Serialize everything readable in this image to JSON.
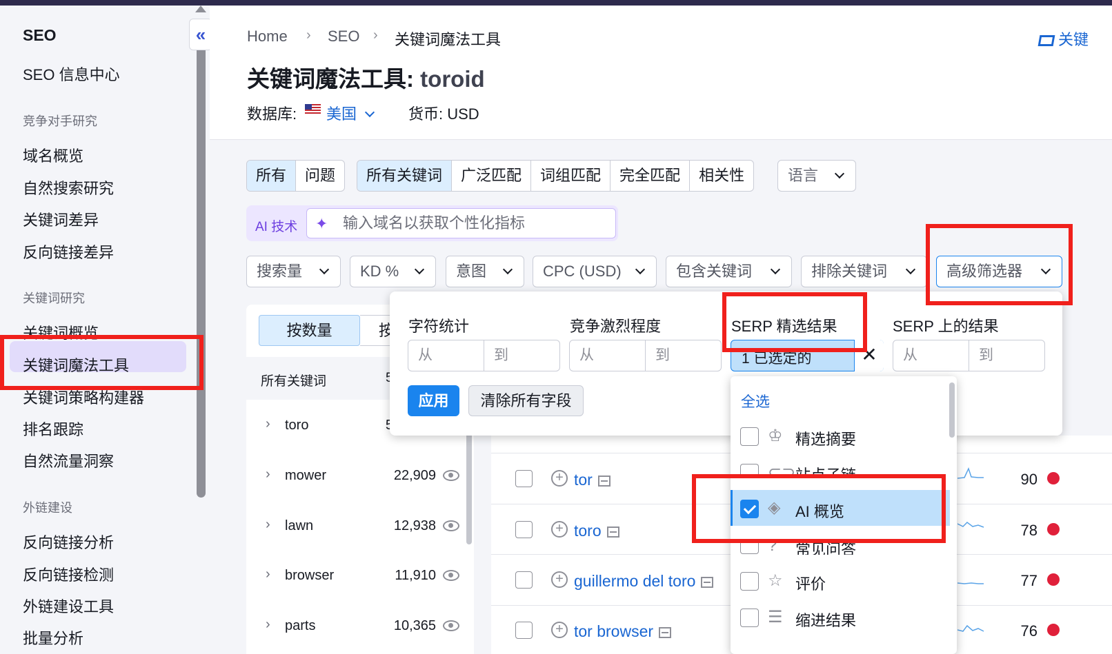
{
  "sidebar": {
    "title": "SEO",
    "items_top": [
      "SEO 信息中心"
    ],
    "sections": [
      {
        "heading": "竞争对手研究",
        "items": [
          "域名概览",
          "自然搜索研究",
          "关键词差异",
          "反向链接差异"
        ]
      },
      {
        "heading": "关键词研究",
        "items": [
          "关键词概览",
          "关键词魔法工具",
          "关键词策略构建器",
          "排名跟踪",
          "自然流量洞察"
        ]
      },
      {
        "heading": "外链建设",
        "items": [
          "反向链接分析",
          "反向链接检测",
          "外链建设工具",
          "批量分析"
        ]
      }
    ],
    "active_item": "关键词魔法工具",
    "collapse_glyph": "«"
  },
  "breadcrumb": [
    "Home",
    "SEO",
    "关键词魔法工具"
  ],
  "breadcrumb_sep": "›",
  "help_link": "关键",
  "page_title": {
    "prefix": "关键词魔法工具:",
    "query": "toroid"
  },
  "database": {
    "label": "数据库:",
    "value": "美国"
  },
  "currency": "货币: USD",
  "tabs_group1": [
    "所有",
    "问题"
  ],
  "tabs_group2": [
    "所有关键词",
    "广泛匹配",
    "词组匹配",
    "完全匹配",
    "相关性"
  ],
  "language_label": "语言",
  "ai": {
    "tag": "AI 技术",
    "placeholder": "输入域名以获取个性化指标"
  },
  "filters": [
    "搜索量",
    "KD %",
    "意图",
    "CPC (USD)",
    "包含关键词",
    "排除关键词",
    "高级筛选器"
  ],
  "group_tabs": [
    "按数量",
    "按"
  ],
  "left_table": {
    "header": "所有关键词",
    "header_count": "5",
    "rows": [
      {
        "kw": "toro",
        "count": "5"
      },
      {
        "kw": "mower",
        "count": "22,909"
      },
      {
        "kw": "lawn",
        "count": "12,938"
      },
      {
        "kw": "browser",
        "count": "11,910"
      },
      {
        "kw": "parts",
        "count": "10,365"
      }
    ]
  },
  "right_table": {
    "rows": [
      {
        "kw": "tor",
        "kd": "90"
      },
      {
        "kw": "toro",
        "kd": "78"
      },
      {
        "kw": "guillermo del toro",
        "kd": "77"
      },
      {
        "kw": "tor browser",
        "kd": "76"
      }
    ],
    "kd_dot_color": "#e0203a"
  },
  "advanced_popup": {
    "labels": [
      "字符统计",
      "竞争激烈程度",
      "SERP 精选结果",
      "SERP 上的结果"
    ],
    "from": "从",
    "to": "到",
    "selected_text": "1 已选定的",
    "clear_x": "✕",
    "apply": "应用",
    "clear_all": "清除所有字段"
  },
  "serp_dropdown": {
    "select_all": "全选",
    "options": [
      {
        "label": "精选摘要",
        "icon": "crown-icon",
        "glyph": "♔",
        "checked": false
      },
      {
        "label": "站点子链",
        "icon": "link-icon",
        "glyph": "⊂⊃",
        "checked": false
      },
      {
        "label": "AI 概览",
        "icon": "ai-icon",
        "glyph": "◈",
        "checked": true
      },
      {
        "label": "常见问答",
        "icon": "question-icon",
        "glyph": "?",
        "checked": false
      },
      {
        "label": "评价",
        "icon": "star-icon",
        "glyph": "☆",
        "checked": false
      },
      {
        "label": "缩进结果",
        "icon": "indent-icon",
        "glyph": "☰",
        "checked": false
      }
    ]
  },
  "colors": {
    "accent": "#1a84ee",
    "link": "#1a66d2",
    "highlight": "#f0201c",
    "active_nav": "#e2dcfb"
  }
}
